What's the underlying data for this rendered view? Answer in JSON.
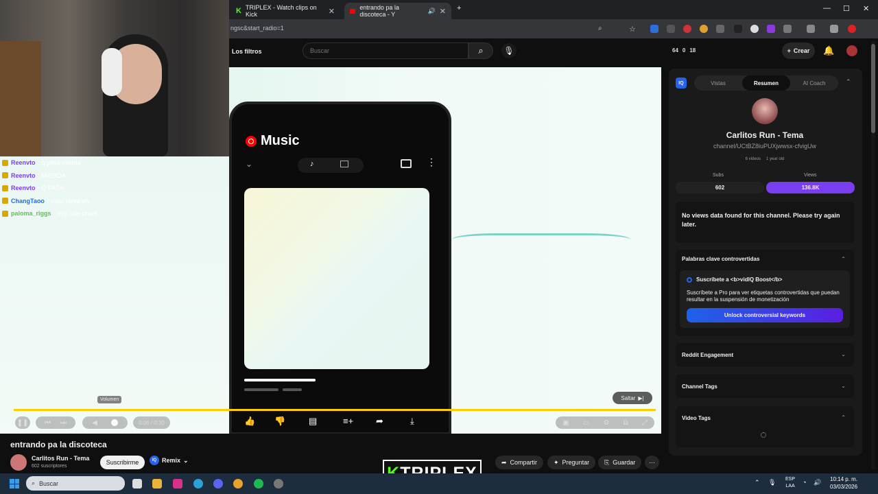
{
  "browser": {
    "tabs": [
      {
        "label": "TRIPLEX - Watch clips on Kick",
        "active": false
      },
      {
        "label": "entrando pa la discoteca - Y",
        "active": true
      }
    ],
    "url": "ngsc&start_radio=1",
    "controls": {
      "minimize": "—",
      "maximize": "☐",
      "close": "✕",
      "newtab": "+"
    }
  },
  "yt_header": {
    "filters": "Los filtros",
    "search_placeholder": "Buscar",
    "stats": [
      "64",
      "0",
      "18"
    ],
    "create": "Crear"
  },
  "player": {
    "app_name": "Music",
    "time": "0:06 / 0:30",
    "progress": 0.2,
    "volume_tooltip": "Volumen",
    "skip": "Saltar"
  },
  "chat": [
    {
      "user": "Reenvto",
      "msg": ": q pasa mierda",
      "ucolor": "#7a3cff",
      "badge": "#d8a800"
    },
    {
      "user": "Reenvto",
      "msg": ": MIERDA",
      "ucolor": "#7a3cff",
      "badge": "#d8a800"
    },
    {
      "user": "Reenvto",
      "msg": ": Q PASA",
      "ucolor": "#7a3cff",
      "badge": "#d8a800"
    },
    {
      "user": "ChangTaoo",
      "msg": ": eseo tarea wn",
      "ucolor": "#1e6fe8",
      "badge": "#d8a800"
    },
    {
      "user": "paloma_riggs",
      "msg": ": hoy sale pravé",
      "ucolor": "#5ac84a",
      "badge": "#d8a800"
    }
  ],
  "video": {
    "title": "entrando pa la discoteca",
    "channel": "Carlitos Run - Tema",
    "subscribers": "602 suscriptores",
    "subscribe": "Suscribirme",
    "remix": "Remix",
    "actions": {
      "share": "Compartir",
      "ask": "Preguntar",
      "save": "Guardar"
    }
  },
  "vidiq": {
    "badge": "IQ",
    "tabs": [
      "Vistas",
      "Resumen",
      "AI Coach"
    ],
    "active_tab": "Resumen",
    "channel_title": "Carlitos Run - Tema",
    "channel_handle": "channel/UCtBZ8iuPUXjwwsx-cfvigUw",
    "meta": [
      "6 videos",
      "1 year old"
    ],
    "subs_label": "Subs",
    "subs_value": "602",
    "views_label": "Views",
    "views_value": "136.8K",
    "no_views": "No views data found for this channel. Please try again later.",
    "sections": {
      "controversial": "Palabras clave controvertidas",
      "boost_title": "Suscríbete a <b>vidIQ Boost</b>",
      "boost_desc": "Suscríbete a Pro para ver etiquetas controvertidas que puedan resultar en la suspensión de monetización",
      "unlock": "Unlock controversial keywords",
      "reddit": "Reddit Engagement",
      "channel_tags": "Channel Tags",
      "video_tags": "Video Tags"
    }
  },
  "taskbar": {
    "search": "Buscar",
    "lang": [
      "ESP",
      "LAA"
    ],
    "time": "10:14 p. m.",
    "date": "03/03/2026"
  },
  "overlay": {
    "logo_k": "K",
    "logo_rest": "TRIPLEX"
  }
}
